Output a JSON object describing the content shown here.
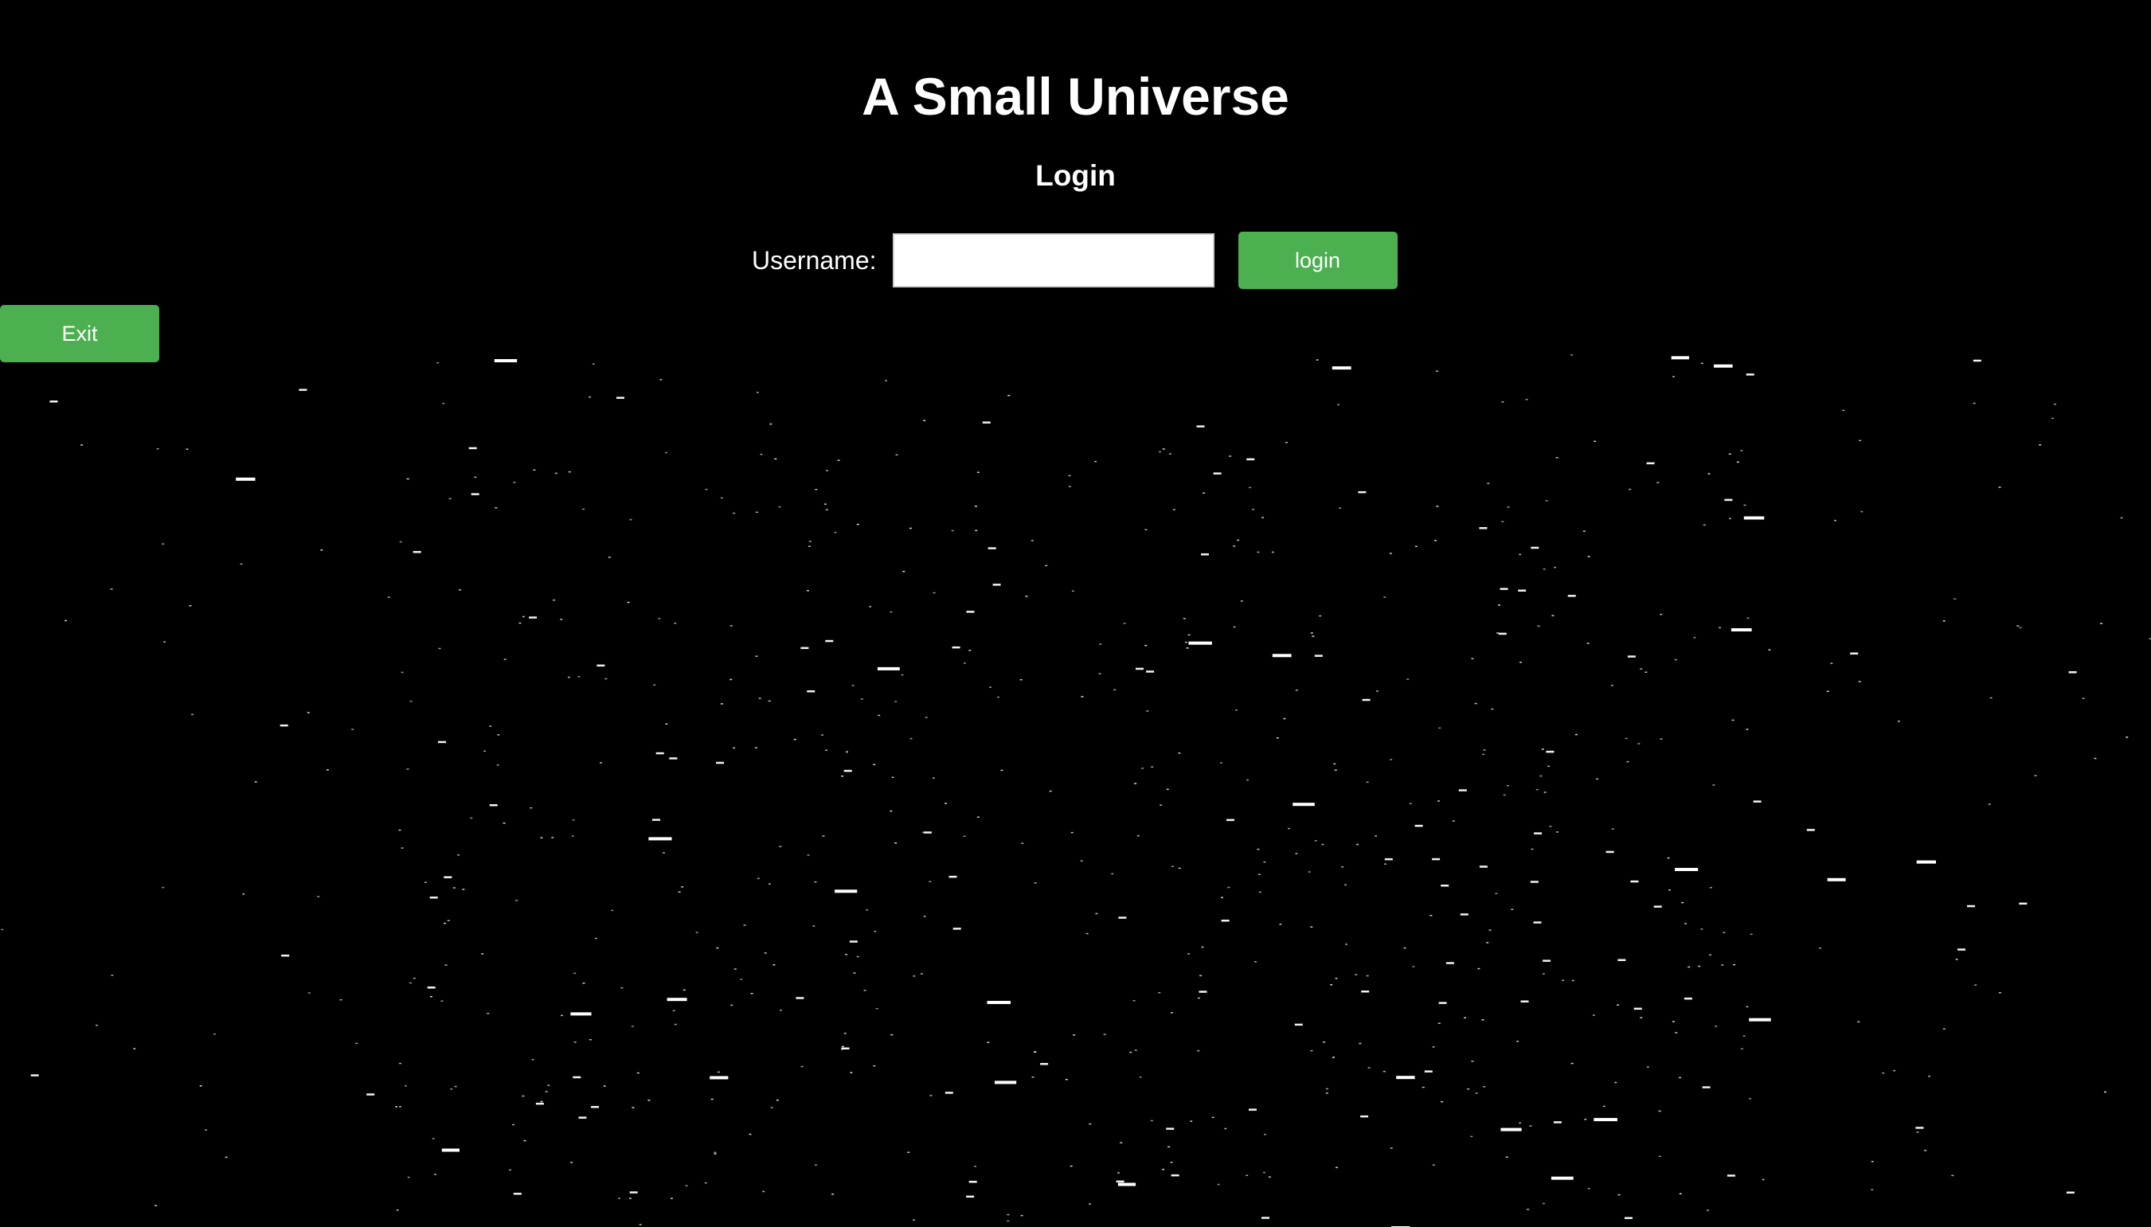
{
  "header": {
    "title": "A Small Universe",
    "subtitle": "Login"
  },
  "login_form": {
    "username_label": "Username:",
    "username_value": "",
    "username_placeholder": "",
    "login_button_label": "login"
  },
  "exit_button_label": "Exit",
  "colors": {
    "background": "#000000",
    "accent": "#4caf50",
    "text": "#ffffff",
    "star": "#ffffff"
  }
}
